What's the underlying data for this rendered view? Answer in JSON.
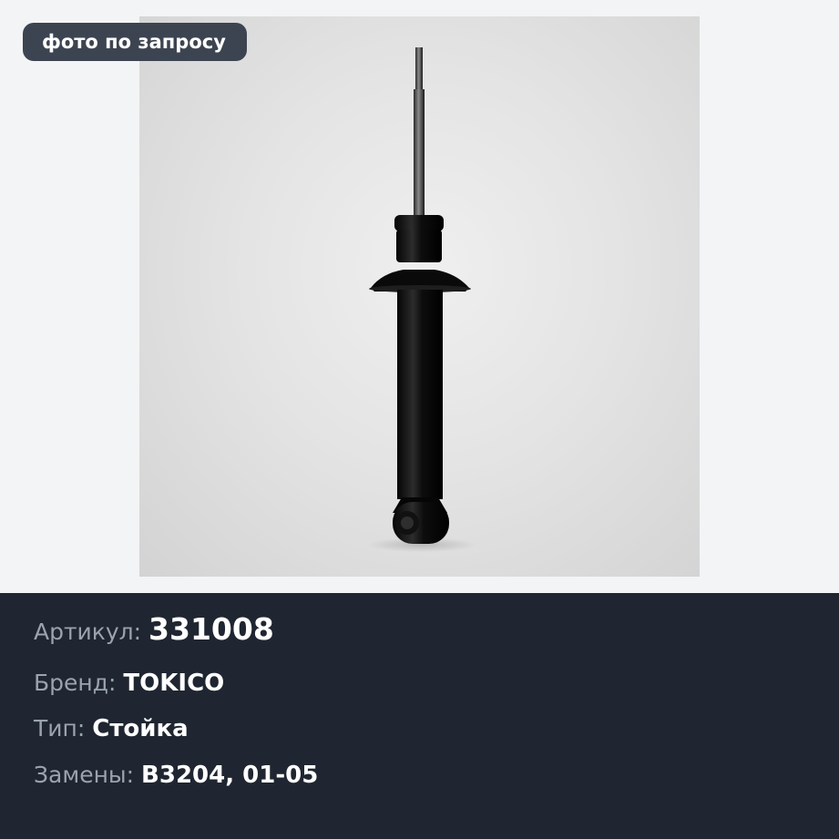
{
  "badge": {
    "text": "фото по запросу"
  },
  "product": {
    "image_subject": "shock-absorber-strut",
    "article_label": "Артикул:",
    "article_value": "331008",
    "brand_label": "Бренд:",
    "brand_value": "TOKICO",
    "type_label": "Тип:",
    "type_value": "Стойка",
    "replacements_label": "Замены:",
    "replacements_value": "B3204, 01-05"
  },
  "colors": {
    "page_background": "#f3f4f6",
    "panel_background": "#1f2631",
    "badge_background": "#3d4451",
    "label_text": "#9aa3ae",
    "value_text": "#ffffff"
  }
}
